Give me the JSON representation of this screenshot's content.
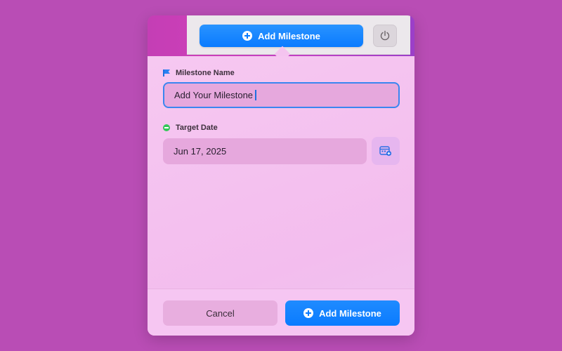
{
  "toolbar": {
    "add_label": "Add Milestone",
    "power_icon": "power-icon"
  },
  "form": {
    "name_label": "Milestone Name",
    "name_value": "Add Your Milestone",
    "date_label": "Target Date",
    "date_value": "Jun 17, 2025",
    "calendar_icon": "calendar-add-icon"
  },
  "footer": {
    "cancel_label": "Cancel",
    "add_label": "Add Milestone"
  },
  "colors": {
    "accent": "#0a7bff",
    "background": "#b94db5",
    "popover": "#f4c4ef",
    "flag": "#2a82f2",
    "target_dot": "#34c759"
  }
}
